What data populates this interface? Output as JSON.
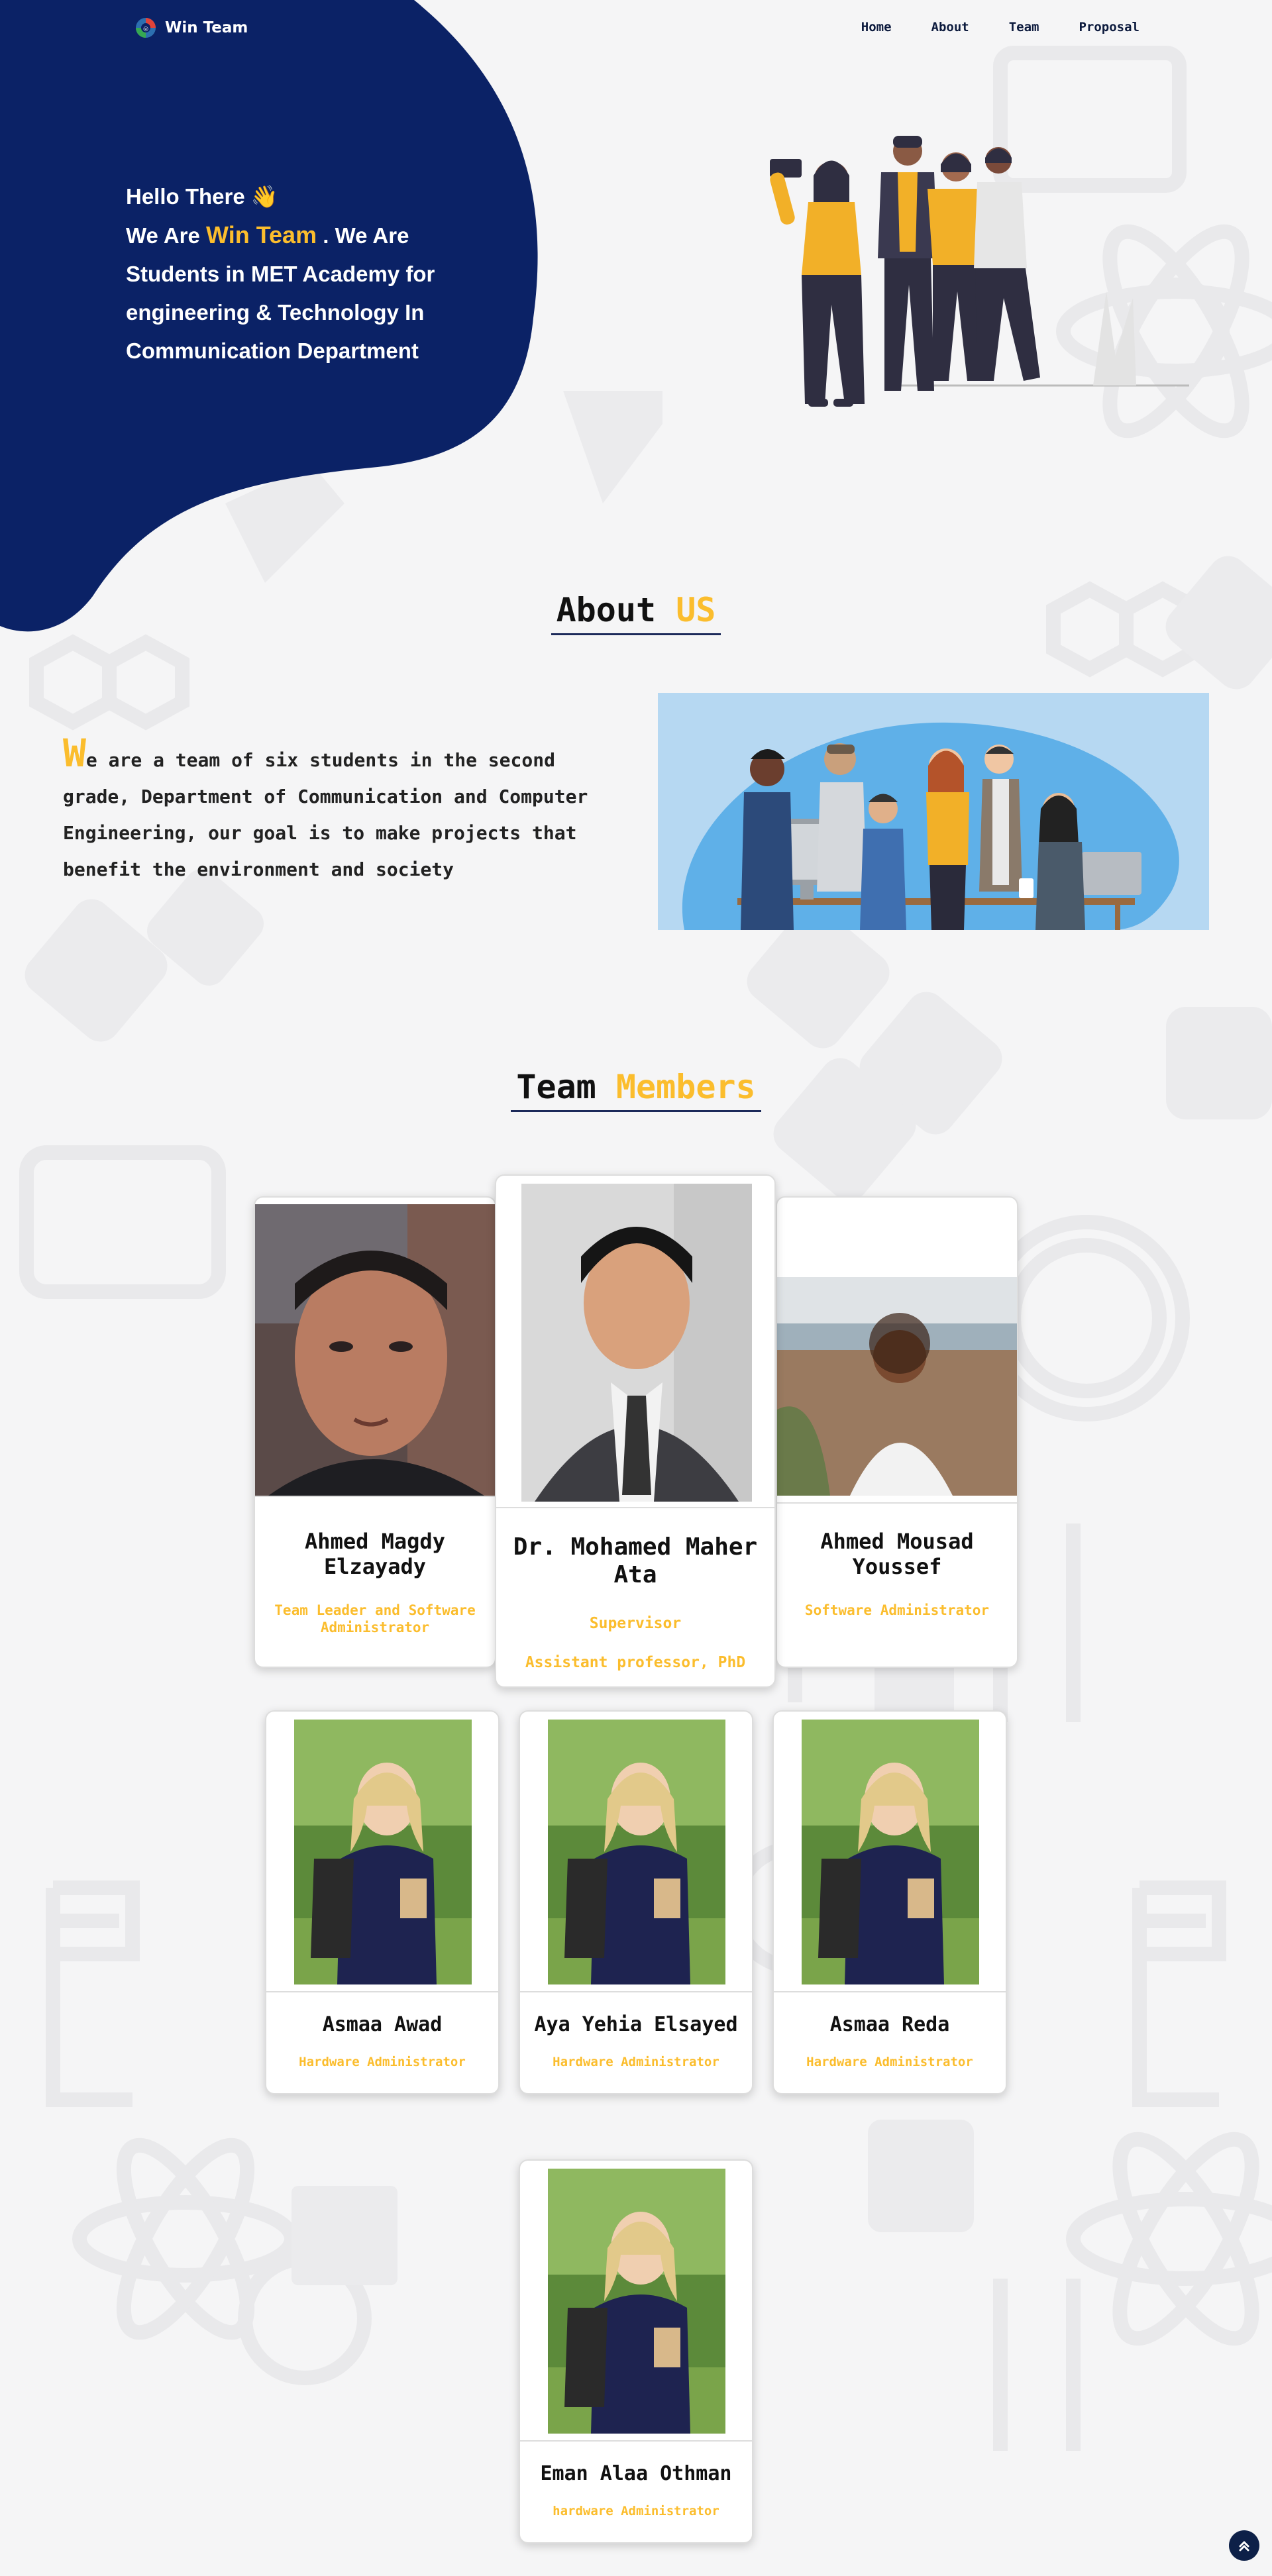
{
  "brand": {
    "name": "Win Team"
  },
  "nav": {
    "items": [
      "Home",
      "About",
      "Team",
      "Proposal"
    ]
  },
  "hero": {
    "greeting": "Hello There",
    "wave": "👋",
    "we_are": "We Are",
    "team_name": "Win Team",
    "rest_line": ". We Are",
    "line3": "Students in MET Academy for",
    "line4": "engineering & Technology In",
    "line5": "Communication Department"
  },
  "about": {
    "title_main": "About",
    "title_accent": "US",
    "cap_letter": "W",
    "text": "e are a team of six students in the second grade, Department of Communication and Computer Engineering, our goal is to make projects that benefit the environment and society"
  },
  "team": {
    "title_main": "Team",
    "title_accent": "Members",
    "members": [
      {
        "name": "Ahmed Magdy Elzayady",
        "role": "Team Leader and Software Administrator"
      },
      {
        "name": "Dr. Mohamed Maher Ata",
        "role": "Supervisor",
        "role2": "Assistant professor, PhD"
      },
      {
        "name": "Ahmed Mousad Youssef",
        "role": "Software Administrator"
      },
      {
        "name": "Asmaa Awad",
        "role": "Hardware Administrator"
      },
      {
        "name": "Aya Yehia Elsayed",
        "role": "Hardware Administrator"
      },
      {
        "name": "Asmaa Reda",
        "role": "Hardware Administrator"
      },
      {
        "name": "Eman Alaa Othman",
        "role": "hardware Administrator"
      }
    ]
  },
  "colors": {
    "navy": "#0b2266",
    "accent": "#fbbd2d",
    "background": "#f5f5f6"
  },
  "icons": {
    "back_to_top": "chevron-double-up-icon",
    "logo": "logo-icon"
  }
}
